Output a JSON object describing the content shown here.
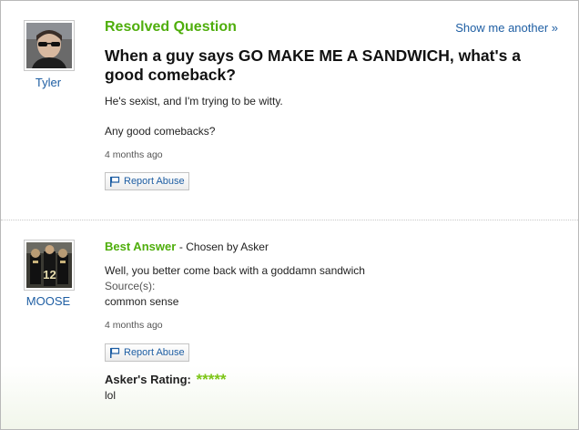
{
  "question": {
    "status_heading": "Resolved Question",
    "show_another": "Show me another »",
    "asker_name": "Tyler",
    "title": "When a guy says GO MAKE ME A SANDWICH, what's a good comeback?",
    "body_line1": "He's sexist, and I'm trying to be witty.",
    "body_line2": "Any good comebacks?",
    "timestamp": "4 months ago",
    "report_label": "Report Abuse"
  },
  "answer": {
    "heading": "Best Answer",
    "chosen_by": "- Chosen by Asker",
    "answerer_name": "MOOSE",
    "text": "Well, you better come back with a goddamn sandwich",
    "sources_label": "Source(s):",
    "sources_value": "common sense",
    "timestamp": "4 months ago",
    "report_label": "Report Abuse",
    "rating_label": "Asker's Rating:",
    "rating_stars": "*****",
    "rating_value": 5,
    "rating_comment": "lol"
  },
  "colors": {
    "accent_green": "#4fae0c",
    "link_blue": "#1e5ea3",
    "star_green": "#7cc516"
  },
  "icons": {
    "report": "flag-icon"
  }
}
